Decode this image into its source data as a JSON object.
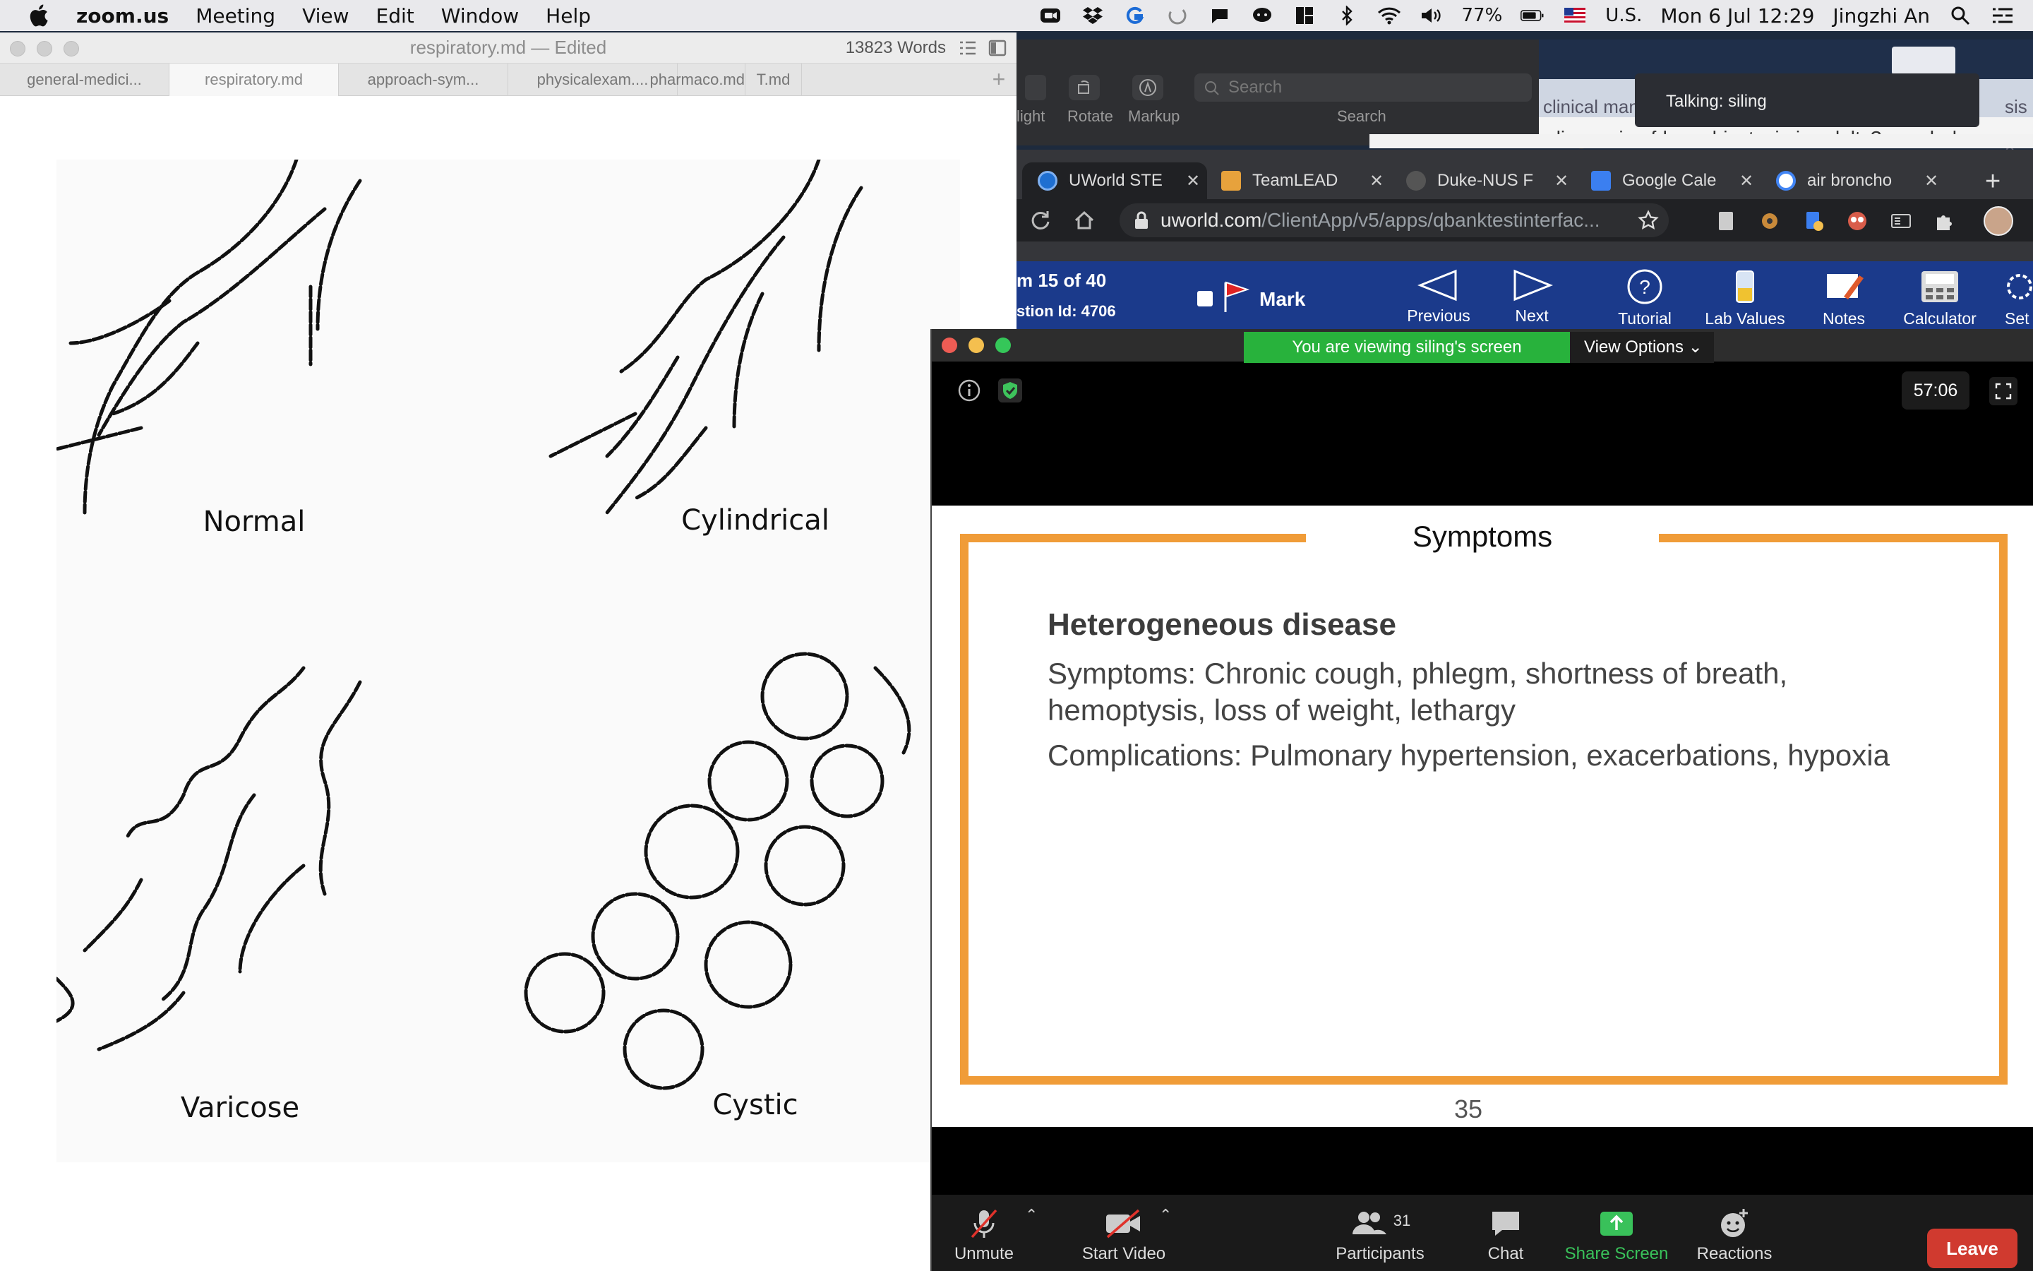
{
  "menubar": {
    "app_name": "zoom.us",
    "menus": [
      "Meeting",
      "View",
      "Edit",
      "Window",
      "Help"
    ],
    "battery": "77%",
    "input_source": "U.S.",
    "datetime": "Mon 6 Jul  12:29",
    "user": "Jingzhi An"
  },
  "typora": {
    "title": "respiratory.md — Edited",
    "word_count": "13823 Words",
    "tabs": [
      "general-medici...",
      "respiratory.md",
      "approach-sym...",
      "physicalexam....",
      "pharmaco.md",
      "T.md"
    ],
    "figure_labels": {
      "normal": "Normal",
      "cylindrical": "Cylindrical",
      "varicose": "Varicose",
      "cystic": "Cystic"
    }
  },
  "preview": {
    "tools": [
      "light",
      "Rotate",
      "Markup"
    ],
    "search_placeholder": "Search",
    "search_label": "Search"
  },
  "background_page": {
    "text1": "clinical man",
    "text1b": "sis in a",
    "url_text": "-diagnosis-of-bronchiectasis-in-adults?search=bron"
  },
  "talking": "Talking: siling",
  "chrome": {
    "tabs": [
      "UWorld STE",
      "TeamLEAD",
      "Duke-NUS F",
      "Google Cale",
      "air broncho"
    ],
    "url_host": "uworld.com",
    "url_path": "/ClientApp/v5/apps/qbanktestinterfac..."
  },
  "uworld": {
    "item_text": "m 15 of 40",
    "question_id": "stion Id: 4706",
    "mark": "Mark",
    "previous": "Previous",
    "next": "Next",
    "tutorial": "Tutorial",
    "lab_values": "Lab Values",
    "notes": "Notes",
    "calculator": "Calculator",
    "settings": "Set"
  },
  "zoom": {
    "banner": "You are viewing siling's screen",
    "view_options": "View Options",
    "timer": "57:06",
    "slide": {
      "title": "Symptoms",
      "heading": "Heterogeneous disease",
      "symptoms": "Symptoms: Chronic cough, phlegm, shortness of breath, hemoptysis, loss of weight, lethargy",
      "complications": "Complications: Pulmonary hypertension, exacerbations, hypoxia",
      "page_number": "35"
    },
    "controls": {
      "unmute": "Unmute",
      "start_video": "Start Video",
      "participants": "Participants",
      "participant_count": "31",
      "chat": "Chat",
      "share_screen": "Share Screen",
      "reactions": "Reactions",
      "leave": "Leave"
    },
    "colors": {
      "accent_green": "#28b23c",
      "share_green": "#39c15a",
      "leave_red": "#d03a2f",
      "slide_orange": "#f09c38"
    }
  }
}
